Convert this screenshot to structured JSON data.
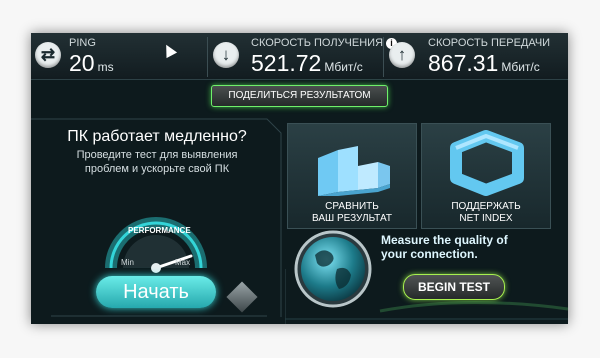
{
  "topbar": {
    "ping": {
      "label": "PING",
      "value": "20",
      "unit": "ms"
    },
    "download": {
      "label": "СКОРОСТЬ ПОЛУЧЕНИЯ",
      "value": "521.72",
      "unit": "Мбит/с"
    },
    "upload": {
      "label": "СКОРОСТЬ ПЕРЕДАЧИ",
      "value": "867.31",
      "unit": "Мбит/с"
    }
  },
  "share_label": "ПОДЕЛИТЬСЯ РЕЗУЛЬТАТОМ",
  "left": {
    "heading": "ПК работает медленно?",
    "subtext": "Проведите тест для выявления проблем и ускорьте свой ПК",
    "gauge": {
      "label": "PERFORMANCE",
      "min": "Min",
      "max": "Max"
    },
    "start_label": "Начать"
  },
  "tiles": {
    "compare_label_line1": "СРАВНИТЬ",
    "compare_label_line2": "ВАШ РЕЗУЛЬТАТ",
    "support_label_line1": "ПОДДЕРЖАТЬ",
    "support_label_line2": "NET INDEX"
  },
  "promo": {
    "line1": "Measure the quality of",
    "line2": "your connection.",
    "begin_label": "BEGIN TEST"
  },
  "colors": {
    "accent_teal": "#31c6cc",
    "accent_green": "#6ff06a"
  },
  "icons": {
    "ping": "swap-arrows-icon",
    "download": "download-arrow-icon",
    "upload": "upload-arrow-icon"
  }
}
